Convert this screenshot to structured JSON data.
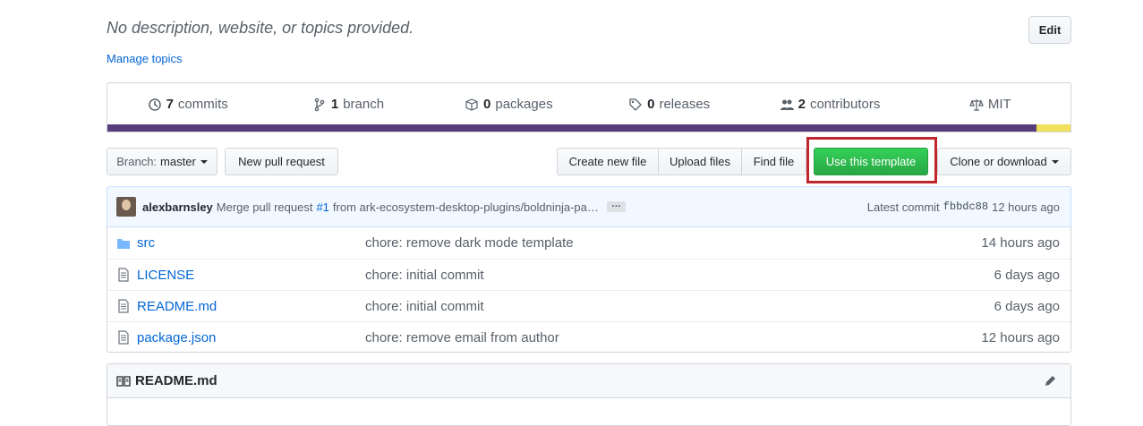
{
  "repo": {
    "description": "No description, website, or topics provided.",
    "edit_label": "Edit",
    "manage_topics": "Manage topics"
  },
  "summary": {
    "commits_count": "7",
    "commits_label": "commits",
    "branches_count": "1",
    "branches_label": "branch",
    "packages_count": "0",
    "packages_label": "packages",
    "releases_count": "0",
    "releases_label": "releases",
    "contributors_count": "2",
    "contributors_label": "contributors",
    "license": "MIT",
    "language_colors": [
      "#563d7c",
      "#f1e05a"
    ],
    "language_fractions": [
      0.965,
      0.035
    ]
  },
  "toolbar": {
    "branch_prefix": "Branch:",
    "branch_name": "master",
    "new_pull_request": "New pull request",
    "create_new_file": "Create new file",
    "upload_files": "Upload files",
    "find_file": "Find file",
    "use_template": "Use this template",
    "clone_download": "Clone or download"
  },
  "commit": {
    "author": "alexbarnsley",
    "message_prefix": "Merge pull request",
    "pr_link": "#1",
    "message_suffix": "from ark-ecosystem-desktop-plugins/boldninja-pa…",
    "ellipsis": "…",
    "latest_label": "Latest commit",
    "sha": "fbbdc88",
    "age": "12 hours ago"
  },
  "files": [
    {
      "icon": "folder-icon",
      "name": "src",
      "message": "chore: remove dark mode template",
      "age": "14 hours ago"
    },
    {
      "icon": "file-icon",
      "name": "LICENSE",
      "message": "chore: initial commit",
      "age": "6 days ago"
    },
    {
      "icon": "file-icon",
      "name": "README.md",
      "message": "chore: initial commit",
      "age": "6 days ago"
    },
    {
      "icon": "file-icon",
      "name": "package.json",
      "message": "chore: remove email from author",
      "age": "12 hours ago"
    }
  ],
  "readme": {
    "title": "README.md"
  }
}
